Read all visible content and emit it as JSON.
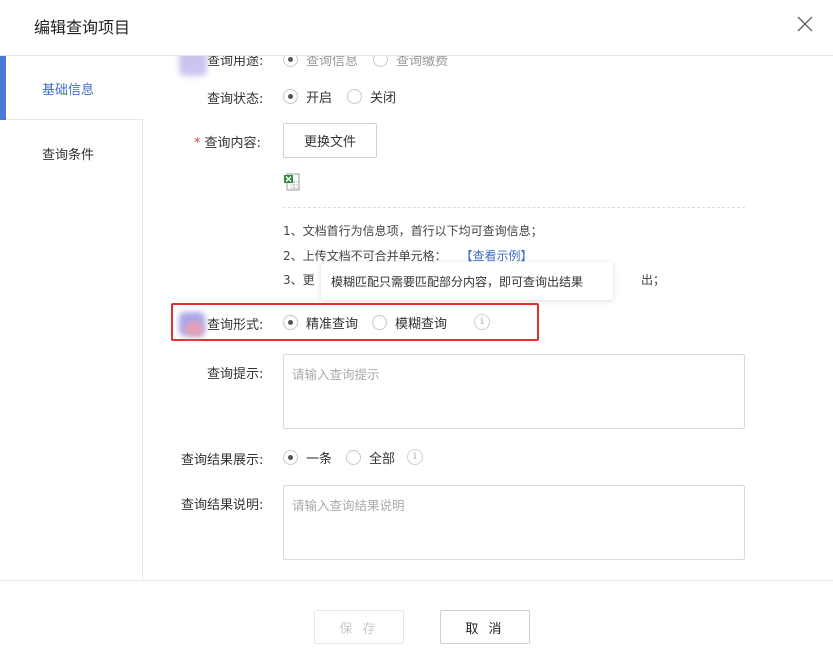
{
  "header": {
    "title": "编辑查询项目"
  },
  "sidebar": {
    "items": [
      {
        "label": "基础信息",
        "active": true
      },
      {
        "label": "查询条件",
        "active": false
      }
    ]
  },
  "form": {
    "purpose": {
      "label": "查询用途:",
      "options": [
        "查询信息",
        "查询缴费"
      ],
      "selected": "查询信息"
    },
    "status": {
      "label": "查询状态:",
      "options": [
        "开启",
        "关闭"
      ],
      "selected": "开启"
    },
    "content": {
      "label": "查询内容:",
      "required_mark": "*",
      "button": "更换文件",
      "notes": [
        "1、文档首行为信息项，首行以下均可查询信息；",
        "2、上传文档不可合并单元格：",
        "3、更",
        "出；"
      ],
      "example_link": "【查看示例】"
    },
    "tooltip": "模糊匹配只需要匹配部分内容，即可查询出结果",
    "mode": {
      "label": "查询形式:",
      "options": [
        "精准查询",
        "模糊查询"
      ],
      "selected": "精准查询",
      "info": "i"
    },
    "hint": {
      "label": "查询提示:",
      "placeholder": "请输入查询提示"
    },
    "result_display": {
      "label": "查询结果展示:",
      "options": [
        "一条",
        "全部"
      ],
      "selected": "一条",
      "info": "i"
    },
    "result_desc": {
      "label": "查询结果说明:",
      "placeholder": "请输入查询结果说明"
    }
  },
  "footer": {
    "save": "保 存",
    "cancel": "取 消"
  },
  "colors": {
    "accent": "#3c6dc5",
    "highlight": "#e52e2e",
    "required": "#e23b3b"
  }
}
